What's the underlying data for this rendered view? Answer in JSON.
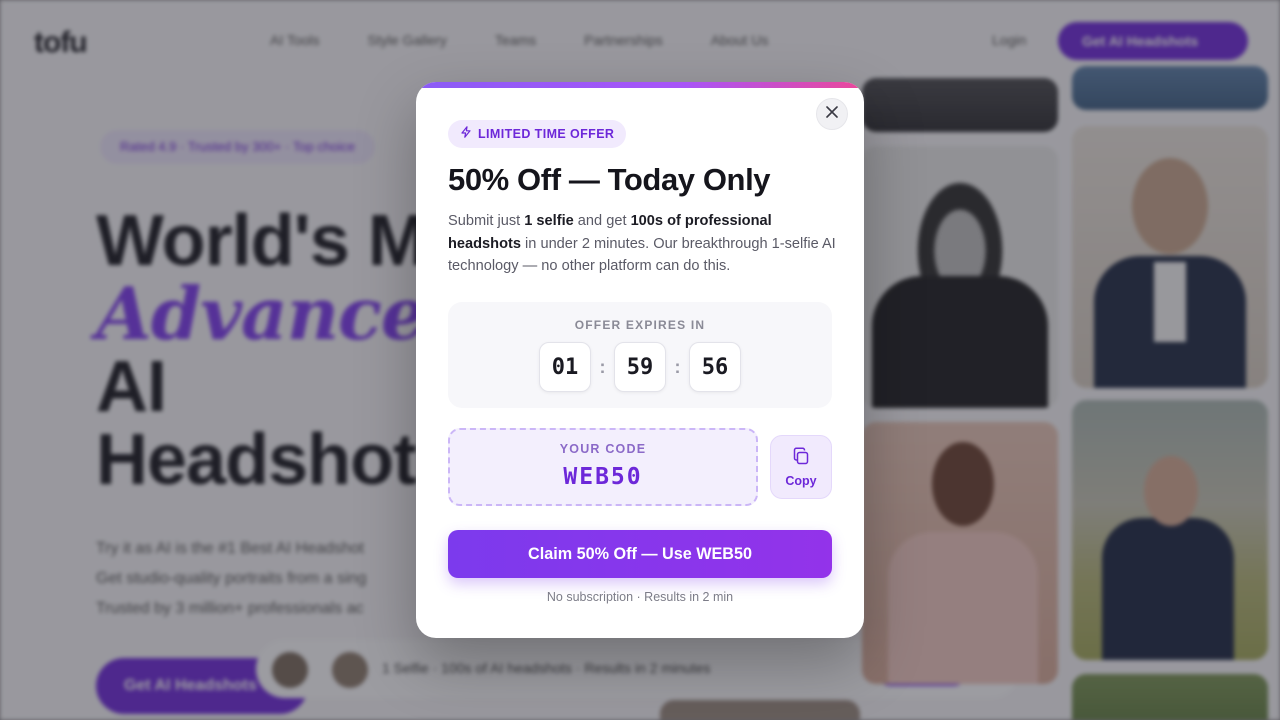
{
  "background": {
    "logo": "tofu",
    "nav_items": [
      "AI Tools",
      "Style Gallery",
      "Teams",
      "Partnerships",
      "About Us"
    ],
    "login": "Login",
    "cta": "Get AI Headshots",
    "pill": "Rated 4.9 · Trusted by 300+ · Top choice",
    "hero_lines": [
      "World's M",
      "Advanced",
      "AI",
      "Headshot"
    ],
    "sub_lines": [
      "Try it as AI is the #1 Best AI Headshot",
      "Get studio-quality portraits from a sing",
      "Trusted by 3 million+ professionals ac"
    ],
    "cta2": "Get AI Headshots",
    "strip_text": "1 Selfie · 100s of AI headshots · Results in 2 minutes"
  },
  "modal": {
    "badge": "LIMITED TIME OFFER",
    "title": "50% Off — Today Only",
    "desc": {
      "p1": "Submit just ",
      "b1": "1 selfie",
      "p2": " and get ",
      "b2": "100s of professional headshots",
      "p3": " in under 2 minutes. Our breakthrough 1-selfie AI technology — no other platform can do this."
    },
    "timer": {
      "label": "OFFER EXPIRES IN",
      "hours": "01",
      "minutes": "59",
      "seconds": "56",
      "separator": ":"
    },
    "code": {
      "label": "YOUR CODE",
      "value": "WEB50"
    },
    "copy_label": "Copy",
    "claim_label": "Claim 50% Off — Use WEB50",
    "footnote": "No subscription · Results in 2 min"
  },
  "icons": {
    "close": "close-icon",
    "badge": "lightning-icon",
    "copy": "copy-icon"
  },
  "colors": {
    "accent": "#7c3aed",
    "accent_dark": "#6d28d9",
    "accent_soft": "#f1eafd",
    "gradient_end": "#ec4899"
  }
}
